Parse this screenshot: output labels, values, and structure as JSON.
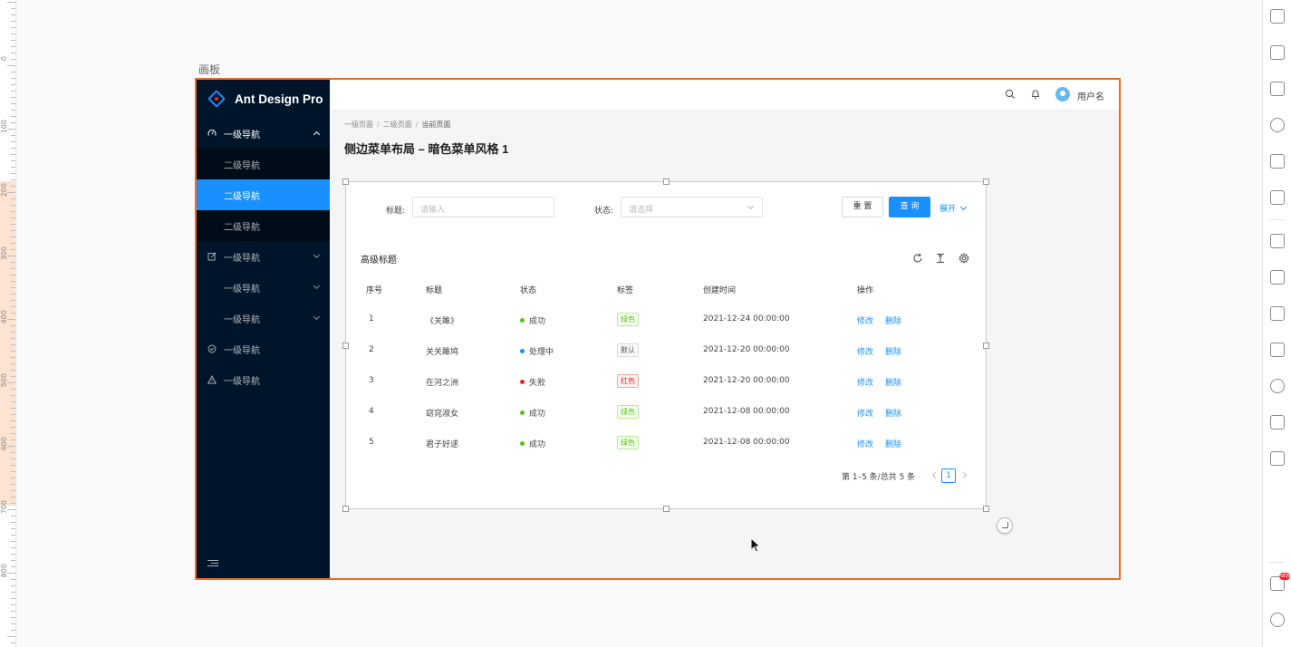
{
  "ruler": {
    "numbers": [
      "0",
      "100",
      "200",
      "300",
      "400",
      "500",
      "600",
      "700",
      "800"
    ]
  },
  "canvas": {
    "artboard_label": "画板"
  },
  "app": {
    "logo_text": "Ant Design Pro",
    "header": {
      "username": "用户名",
      "icons": [
        "search-icon",
        "bell-icon",
        "avatar"
      ]
    },
    "sidebar": {
      "items": [
        {
          "label": "一级导航",
          "icon": "dashboard-icon",
          "open": true,
          "children": [
            {
              "label": "二级导航",
              "active": false
            },
            {
              "label": "二级导航",
              "active": true
            },
            {
              "label": "二级导航",
              "active": false
            }
          ]
        },
        {
          "label": "一级导航",
          "icon": "form-icon"
        },
        {
          "label": "一级导航",
          "icon": "none"
        },
        {
          "label": "一级导航",
          "icon": "none"
        },
        {
          "label": "一级导航",
          "icon": "check-circle-icon"
        },
        {
          "label": "一级导航",
          "icon": "warning-icon"
        }
      ]
    },
    "breadcrumb": [
      "一级页面",
      "二级页面",
      "当前页面"
    ],
    "breadcrumb_sep": "/",
    "page_title": "侧边菜单布局 – 暗色菜单风格 1",
    "filter": {
      "title_label": "标题:",
      "title_placeholder": "请输入",
      "status_label": "状态:",
      "status_placeholder": "请选择",
      "reset_label": "重 置",
      "query_label": "查 询",
      "expand_label": "展开"
    },
    "table": {
      "title": "高级标题",
      "columns": [
        "序号",
        "标题",
        "状态",
        "标签",
        "创建时间",
        "操作"
      ],
      "rows": [
        {
          "no": "1",
          "title": "《关雎》",
          "status": "成功",
          "status_color": "#52c41a",
          "tag": "绿色",
          "tag_type": "green",
          "time": "2021-12-24 00:00:00",
          "edit": "修改",
          "delete": "删除"
        },
        {
          "no": "2",
          "title": "关关雎鸠",
          "status": "处理中",
          "status_color": "#1890ff",
          "tag": "默认",
          "tag_type": "gray",
          "time": "2021-12-20 00:00:00",
          "edit": "修改",
          "delete": "删除"
        },
        {
          "no": "3",
          "title": "在河之洲",
          "status": "失败",
          "status_color": "#f5222d",
          "tag": "红色",
          "tag_type": "red",
          "time": "2021-12-20 00:00:00",
          "edit": "修改",
          "delete": "删除"
        },
        {
          "no": "4",
          "title": "窈窕淑女",
          "status": "成功",
          "status_color": "#52c41a",
          "tag": "绿色",
          "tag_type": "green",
          "time": "2021-12-08 00:00:00",
          "edit": "修改",
          "delete": "删除"
        },
        {
          "no": "5",
          "title": "君子好逑",
          "status": "成功",
          "status_color": "#52c41a",
          "tag": "绿色",
          "tag_type": "green",
          "time": "2021-12-08 00:00:00",
          "edit": "修改",
          "delete": "删除"
        }
      ],
      "pagination": {
        "total_text": "第 1–5 条/总共 5 条",
        "current": "1"
      }
    }
  },
  "colors": {
    "primary": "#1890ff",
    "sider_bg": "#001529",
    "frame_border": "#f06b23"
  }
}
